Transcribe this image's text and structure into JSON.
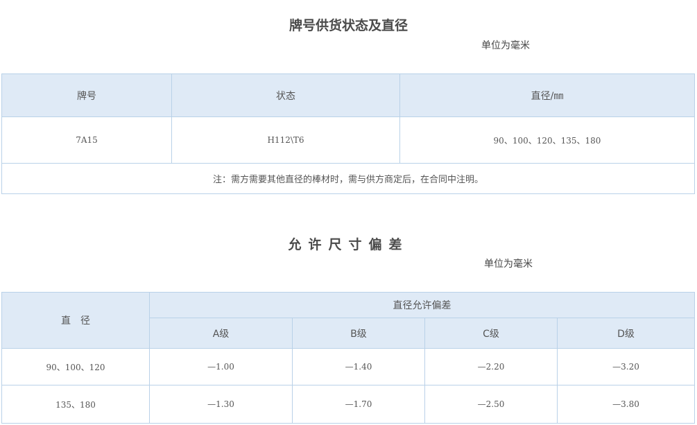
{
  "section1": {
    "title": "牌号供货状态及直径",
    "unit": "单位为毫米",
    "headers": [
      "牌号",
      "状态",
      "直径/㎜"
    ],
    "row": [
      "7A15",
      "H112\\T6",
      "90、100、120、135、180"
    ],
    "note": "注：需方需要其他直径的棒材时，需与供方商定后，在合同中注明。"
  },
  "section2": {
    "title": "允许尺寸偏差",
    "unit": "单位为毫米",
    "header_diameter": "直　径",
    "header_group": "直径允许偏差",
    "grades": [
      "A级",
      "B级",
      "C级",
      "D级"
    ],
    "rows": [
      {
        "diameter": "90、100、120",
        "values": [
          "—1.00",
          "—1.40",
          "—2.20",
          "—3.20"
        ]
      },
      {
        "diameter": "135、180",
        "values": [
          "—1.30",
          "—1.70",
          "—2.50",
          "—3.80"
        ]
      }
    ]
  }
}
